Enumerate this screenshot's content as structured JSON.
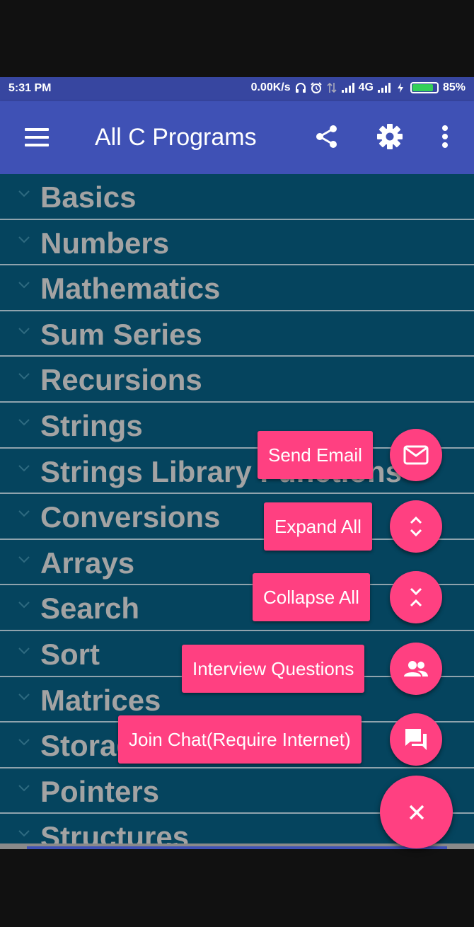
{
  "status_bar": {
    "time": "5:31 PM",
    "network_speed": "0.00K/s",
    "network_type": "4G",
    "battery_percent": "85%",
    "battery_level": 0.85,
    "icons": [
      "headphones-icon",
      "alarm-icon",
      "data-transfer-icon",
      "signal-icon",
      "signal-icon",
      "charging-icon",
      "battery-icon"
    ]
  },
  "app_bar": {
    "title": "All C Programs",
    "icons": [
      "menu-icon",
      "share-icon",
      "settings-icon",
      "more-vert-icon"
    ]
  },
  "categories": [
    "Basics",
    "Numbers",
    "Mathematics",
    "Sum Series",
    "Recursions",
    "Strings",
    "Strings Library Functions",
    "Conversions",
    "Arrays",
    "Search",
    "Sort",
    "Matrices",
    "Storage Classes",
    "Pointers",
    "Structures"
  ],
  "fab_menu": {
    "items": [
      {
        "label": "Send Email",
        "icon": "email-icon"
      },
      {
        "label": "Expand All",
        "icon": "expand-icon"
      },
      {
        "label": "Collapse All",
        "icon": "collapse-icon"
      },
      {
        "label": "Interview Questions",
        "icon": "people-icon"
      },
      {
        "label": "Join Chat(Require Internet)",
        "icon": "chat-icon"
      }
    ],
    "close_icon": "close-icon"
  },
  "colors": {
    "status_bar": "#3746a0",
    "app_bar": "#3f51b5",
    "list_background": "#05445e",
    "list_text": "#a3a3a3",
    "accent": "#ff4081",
    "battery": "#34d058"
  }
}
